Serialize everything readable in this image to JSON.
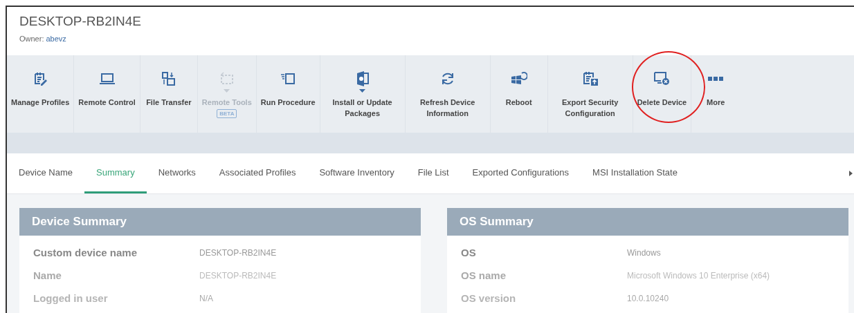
{
  "header": {
    "title": "DESKTOP-RB2IN4E",
    "owner_label": "Owner:",
    "owner": "abevz"
  },
  "toolbar": [
    {
      "label": "Manage Profiles",
      "disabled": false,
      "dropdown": false,
      "highlighted": false
    },
    {
      "label": "Remote Control",
      "disabled": false,
      "dropdown": false,
      "highlighted": false
    },
    {
      "label": "File Transfer",
      "disabled": false,
      "dropdown": false,
      "highlighted": false
    },
    {
      "label": "Remote Tools",
      "disabled": true,
      "dropdown": true,
      "badge": "BETA",
      "highlighted": false
    },
    {
      "label": "Run Procedure",
      "disabled": false,
      "dropdown": false,
      "highlighted": false
    },
    {
      "label": "Install or Update Packages",
      "disabled": false,
      "dropdown": true,
      "highlighted": false
    },
    {
      "label": "Refresh Device Information",
      "disabled": false,
      "dropdown": false,
      "highlighted": false
    },
    {
      "label": "Reboot",
      "disabled": false,
      "dropdown": false,
      "highlighted": false
    },
    {
      "label": "Export Security Configuration",
      "disabled": false,
      "dropdown": false,
      "highlighted": false
    },
    {
      "label": "Delete Device",
      "disabled": false,
      "dropdown": false,
      "highlighted": true
    },
    {
      "label": "More",
      "disabled": false,
      "dropdown": false,
      "highlighted": false
    }
  ],
  "tabs": [
    {
      "label": "Device Name",
      "selected": false
    },
    {
      "label": "Summary",
      "selected": true
    },
    {
      "label": "Networks",
      "selected": false
    },
    {
      "label": "Associated Profiles",
      "selected": false
    },
    {
      "label": "Software Inventory",
      "selected": false
    },
    {
      "label": "File List",
      "selected": false
    },
    {
      "label": "Exported Configurations",
      "selected": false
    },
    {
      "label": "MSI Installation State",
      "selected": false
    }
  ],
  "panels": [
    {
      "title": "Device Summary",
      "rows": [
        {
          "label": "Custom device name",
          "value": "DESKTOP-RB2IN4E"
        },
        {
          "label": "Name",
          "value": "DESKTOP-RB2IN4E"
        },
        {
          "label": "Logged in user",
          "value": "N/A"
        }
      ]
    },
    {
      "title": "OS Summary",
      "rows": [
        {
          "label": "OS",
          "value": "Windows"
        },
        {
          "label": "OS name",
          "value": "Microsoft Windows 10 Enterprise (x64)"
        },
        {
          "label": "OS version",
          "value": "10.0.10240"
        }
      ]
    }
  ]
}
